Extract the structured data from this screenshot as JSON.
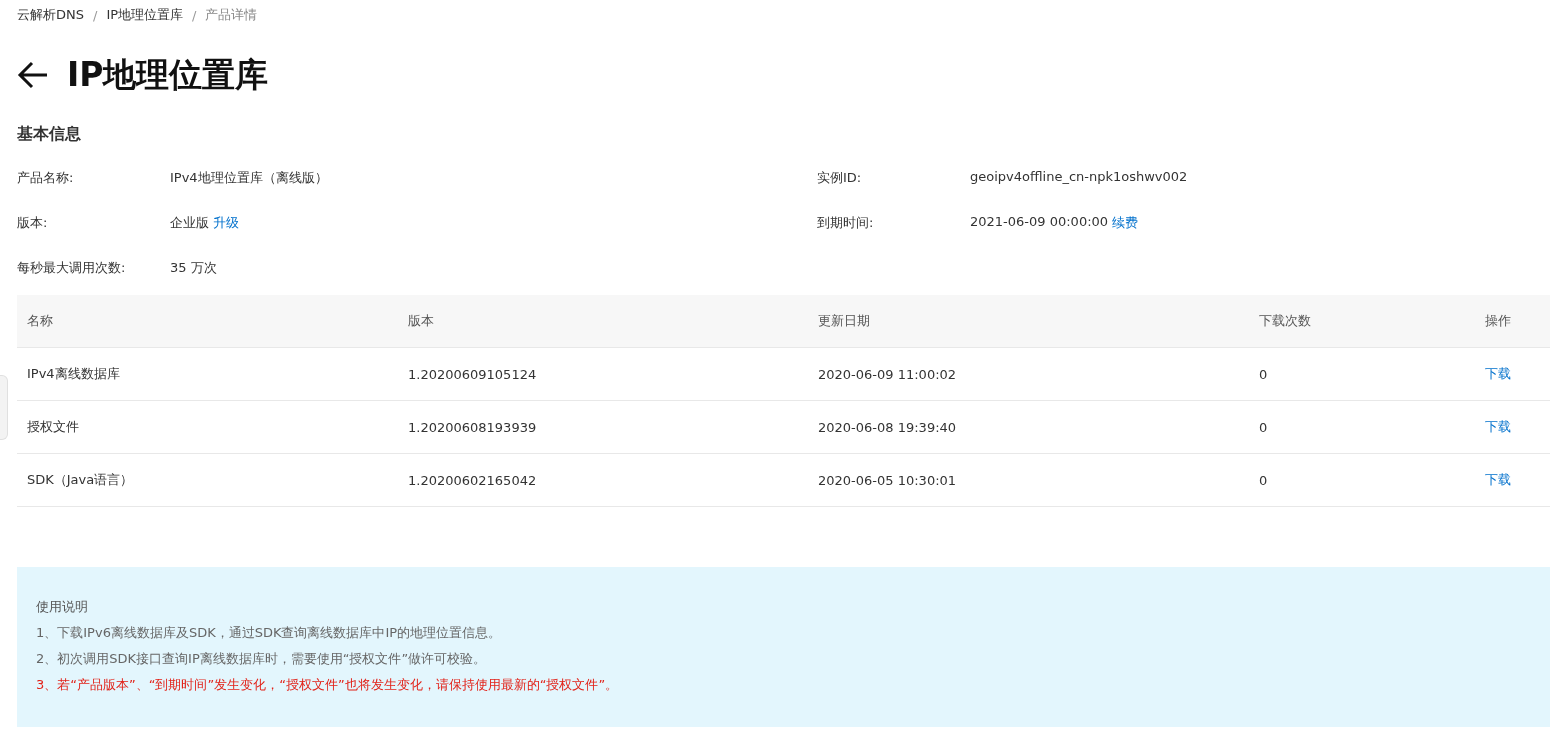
{
  "breadcrumb": [
    {
      "label": "云解析DNS",
      "current": false
    },
    {
      "label": "IP地理位置库",
      "current": false
    },
    {
      "label": "产品详情",
      "current": true
    }
  ],
  "breadcrumb_separator": "/",
  "page_title": "IP地理位置库",
  "section_title": "基本信息",
  "info": [
    {
      "label": "产品名称:",
      "value": "IPv4地理位置库（离线版）"
    },
    {
      "label": "实例ID:",
      "value": "geoipv4offline_cn-npk1oshwv002"
    },
    {
      "label": "版本:",
      "value": "企业版",
      "link": "升级"
    },
    {
      "label": "到期时间:",
      "value": "2021-06-09 00:00:00",
      "link": "续费"
    },
    {
      "label": "每秒最大调用次数:",
      "value": "35 万次"
    }
  ],
  "table": {
    "columns": [
      "名称",
      "版本",
      "更新日期",
      "下载次数",
      "操作"
    ],
    "rows": [
      {
        "name": "IPv4离线数据库",
        "version": "1.20200609105124",
        "date": "2020-06-09 11:00:02",
        "downloads": "0",
        "action": "下载"
      },
      {
        "name": "授权文件",
        "version": "1.20200608193939",
        "date": "2020-06-08 19:39:40",
        "downloads": "0",
        "action": "下载"
      },
      {
        "name": "SDK（Java语言）",
        "version": "1.20200602165042",
        "date": "2020-06-05 10:30:01",
        "downloads": "0",
        "action": "下载"
      }
    ]
  },
  "notes": {
    "title": "使用说明",
    "lines": [
      {
        "text": "1、下载IPv6离线数据库及SDK，通过SDK查询离线数据库中IP的地理位置信息。",
        "kind": "normal"
      },
      {
        "text": "2、初次调用SDK接口查询IP离线数据库时，需要使用“授权文件”做许可校验。",
        "kind": "normal"
      },
      {
        "text": "3、若“产品版本”、“到期时间”发生变化，“授权文件”也将发生变化，请保持使用最新的“授权文件”。",
        "kind": "warning"
      }
    ]
  }
}
